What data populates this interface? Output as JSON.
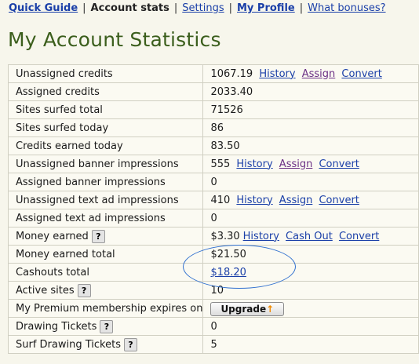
{
  "nav": {
    "quick_guide": "Quick Guide",
    "account_stats": "Account stats",
    "settings": "Settings",
    "my_profile": "My Profile",
    "what_bonuses": "What bonuses?",
    "separator": "|"
  },
  "page_title": "My Account Statistics",
  "rows": {
    "unassigned_credits": {
      "label": "Unassigned credits",
      "value": "1067.19",
      "history": "History",
      "assign": "Assign",
      "convert": "Convert"
    },
    "assigned_credits": {
      "label": "Assigned credits",
      "value": "2033.40"
    },
    "sites_surfed_total": {
      "label": "Sites surfed total",
      "value": "71526"
    },
    "sites_surfed_today": {
      "label": "Sites surfed today",
      "value": "86"
    },
    "credits_earned_today": {
      "label": "Credits earned today",
      "value": "83.50"
    },
    "unassigned_banner": {
      "label": "Unassigned banner impressions",
      "value": "555",
      "history": "History",
      "assign": "Assign",
      "convert": "Convert"
    },
    "assigned_banner": {
      "label": "Assigned banner impressions",
      "value": "0"
    },
    "unassigned_text_ad": {
      "label": "Unassigned text ad impressions",
      "value": "410",
      "history": "History",
      "assign": "Assign",
      "convert": "Convert"
    },
    "assigned_text_ad": {
      "label": "Assigned text ad impressions",
      "value": "0"
    },
    "money_earned": {
      "label": "Money earned",
      "help": "?",
      "value": "$3.30",
      "history": "History",
      "cash_out": "Cash Out",
      "convert": "Convert"
    },
    "money_earned_total": {
      "label": "Money earned total",
      "value": "$21.50"
    },
    "cashouts_total": {
      "label": "Cashouts total",
      "value": "$18.20"
    },
    "active_sites": {
      "label": "Active sites",
      "help": "?",
      "value": "10"
    },
    "premium_membership": {
      "label": "My Premium membership expires on",
      "button": "Upgrade",
      "arrow": "↑"
    },
    "drawing_tickets": {
      "label": "Drawing Tickets",
      "help": "?",
      "value": "0"
    },
    "surf_drawing_tickets": {
      "label": "Surf Drawing Tickets",
      "help": "?",
      "value": "5"
    }
  },
  "colors": {
    "background": "#f7f6ec",
    "title": "#3b5e1c",
    "link": "#1a3fa8",
    "visited_link": "#6b2f85",
    "annotation_circle": "#2f6fcf"
  }
}
